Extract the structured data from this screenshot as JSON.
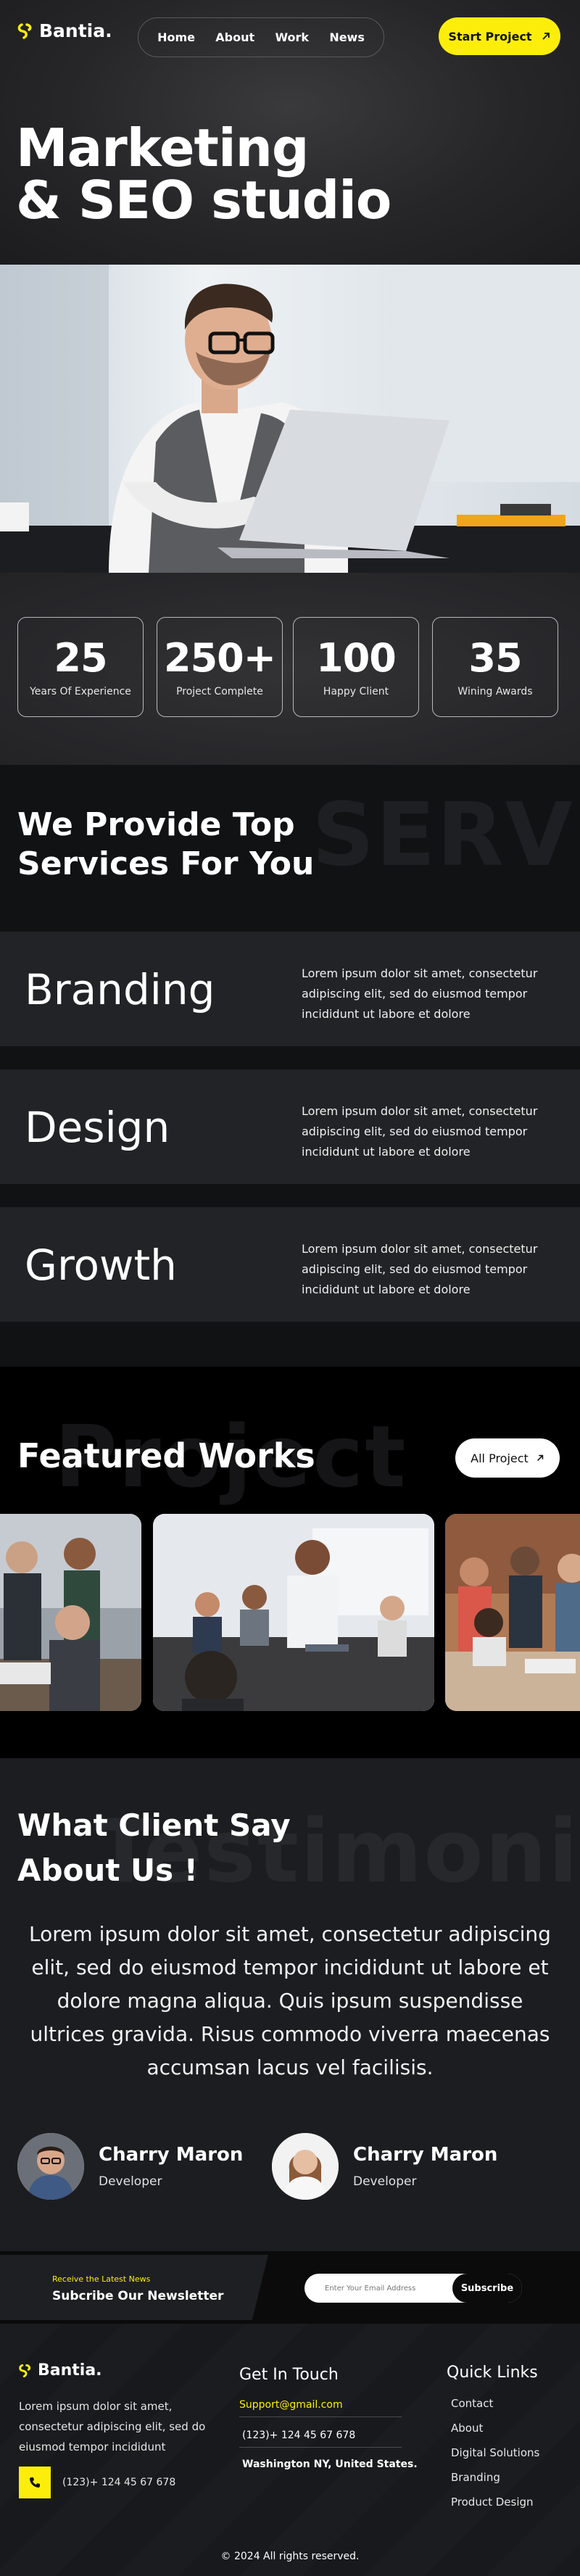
{
  "brand": {
    "name": "Bantia.",
    "accent": "#fcee0a"
  },
  "nav": {
    "items": [
      "Home",
      "About",
      "Work",
      "News"
    ],
    "cta": "Start Project"
  },
  "hero": {
    "title_line1": "Marketing",
    "title_line2": "& SEO studio"
  },
  "stats": [
    {
      "value": "25",
      "label": "Years Of Experience"
    },
    {
      "value": "250+",
      "label": "Project Complete"
    },
    {
      "value": "100",
      "label": "Happy Client"
    },
    {
      "value": "35",
      "label": "Wining Awards"
    }
  ],
  "services": {
    "watermark": "SERVICES",
    "title_line1": "We Provide Top",
    "title_line2": "Services For You",
    "items": [
      {
        "name": "Branding",
        "description": "Lorem ipsum dolor sit amet, consectetur adipiscing elit, sed do eiusmod tempor incididunt ut labore et dolore"
      },
      {
        "name": "Design",
        "description": "Lorem ipsum dolor sit amet, consectetur adipiscing elit, sed do eiusmod tempor incididunt ut labore et dolore"
      },
      {
        "name": "Growth",
        "description": "Lorem ipsum dolor sit amet, consectetur adipiscing elit, sed do eiusmod tempor incididunt ut labore et dolore"
      }
    ]
  },
  "works": {
    "watermark": "Project",
    "title": "Featured Works",
    "button": "All Project"
  },
  "testimonials": {
    "watermark": "Testimonial",
    "title_line1": "What Client Say",
    "title_line2": "About Us !",
    "quote": "Lorem ipsum dolor sit amet, consectetur adipiscing elit, sed do eiusmod tempor incididunt ut labore et dolore magna aliqua. Quis ipsum suspendisse ultrices gravida. Risus commodo viverra maecenas accumsan lacus vel facilisis.",
    "people": [
      {
        "name": "Charry Maron",
        "role": "Developer"
      },
      {
        "name": "Charry Maron",
        "role": "Developer"
      }
    ]
  },
  "newsletter": {
    "kicker": "Receive the Latest News",
    "title": "Subcribe Our Newsletter",
    "placeholder": "Enter Your Email Address",
    "button": "Subscribe"
  },
  "footer": {
    "about": "Lorem ipsum dolor sit amet, consectetur adipiscing elit, sed do eiusmod tempor incididunt",
    "phone": "(123)+ 124 45 67 678",
    "contact_title": "Get In Touch",
    "email": "Support@gmail.com",
    "contact_phone": "(123)+ 124 45 67 678",
    "address": "Washington NY, United States.",
    "links_title": "Quick Links",
    "links": [
      "Contact",
      "About",
      "Digital Solutions",
      "Branding",
      "Product Design"
    ],
    "copyright": "© 2024 All rights reserved."
  }
}
